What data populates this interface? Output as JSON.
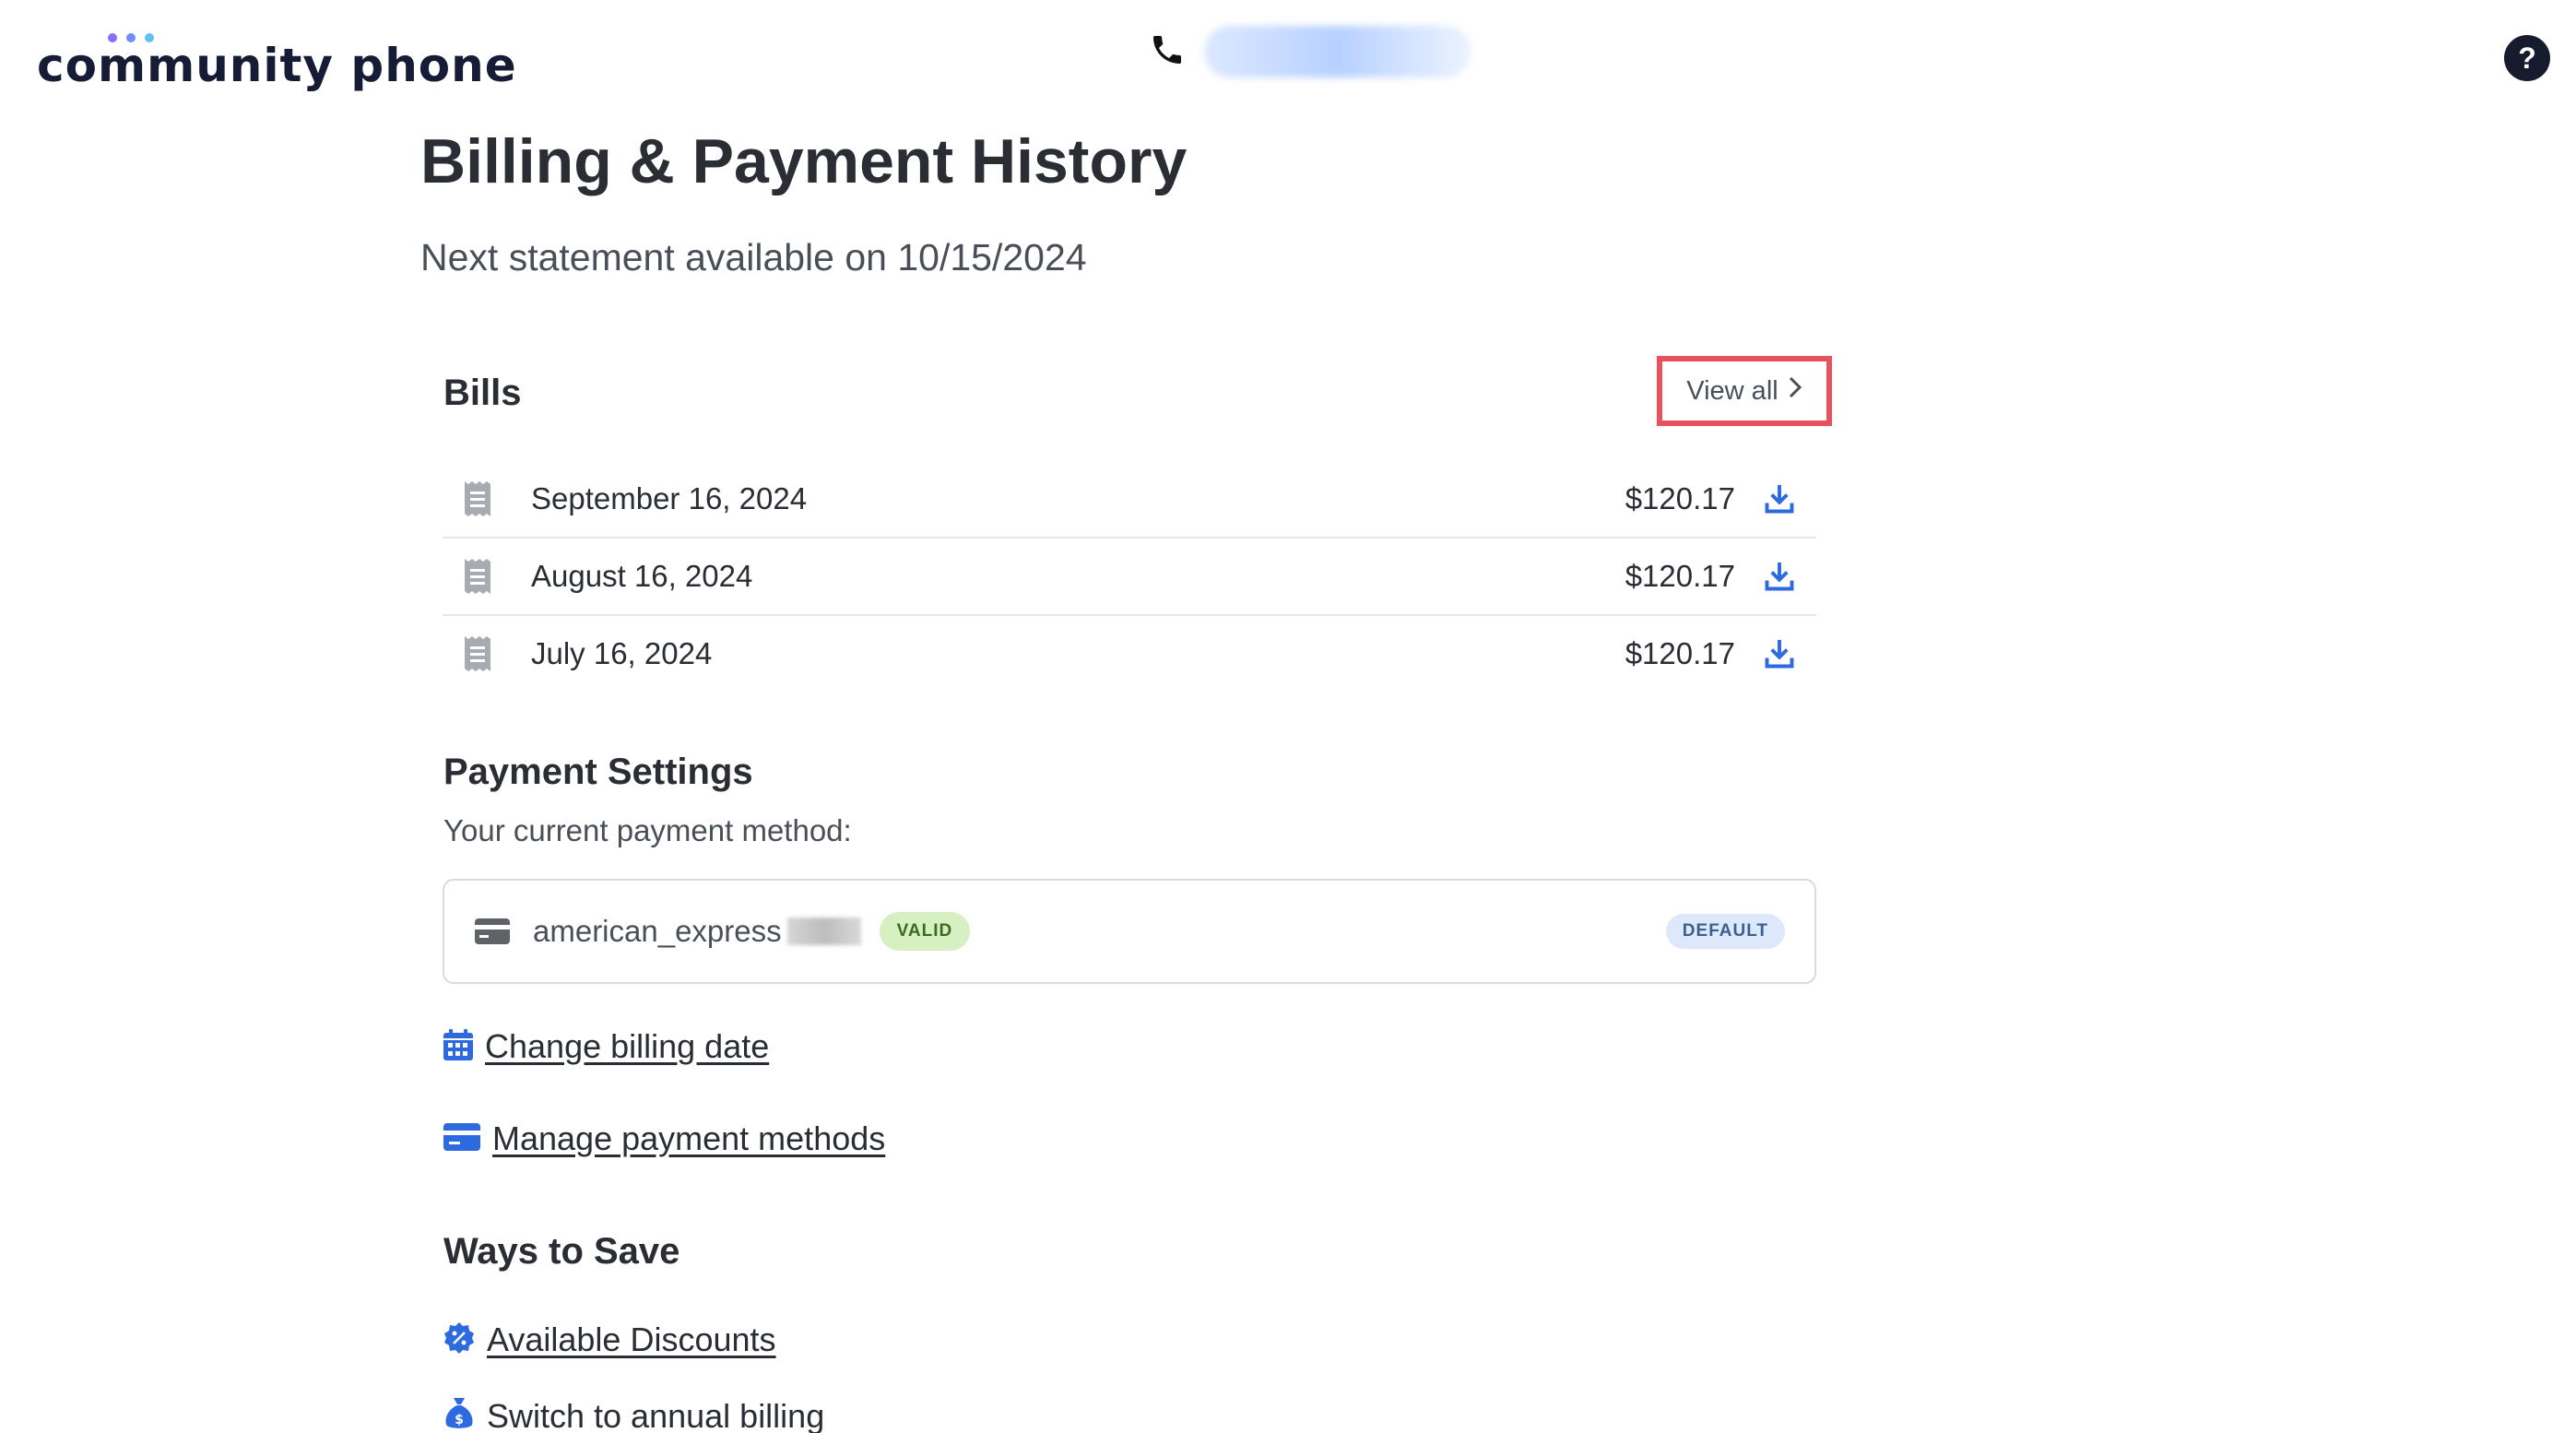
{
  "header": {
    "logo_text": "community phone",
    "logo_dot_colors": [
      "#8b6cf6",
      "#6f8cf8",
      "#5cc2f0"
    ],
    "phone_number_hidden": true,
    "help_icon": "question-circle-icon",
    "help_label": "?"
  },
  "page": {
    "title": "Billing & Payment History",
    "subtitle": "Next statement available on 10/15/2024"
  },
  "bills": {
    "heading": "Bills",
    "view_all_label": "View all",
    "view_all_icon": "chevron-right-icon",
    "highlight_color": "#e8515e",
    "items": [
      {
        "date": "September 16, 2024",
        "amount": "$120.17"
      },
      {
        "date": "August 16, 2024",
        "amount": "$120.17"
      },
      {
        "date": "July 16, 2024",
        "amount": "$120.17"
      }
    ]
  },
  "payment_settings": {
    "heading": "Payment Settings",
    "current_label": "Your current payment method:",
    "method": {
      "name": "american_express",
      "number_hidden": true,
      "status_badge": "VALID",
      "default_badge": "DEFAULT"
    },
    "links": {
      "change_billing_date": "Change billing date",
      "manage_payment_methods": "Manage payment methods"
    }
  },
  "ways_to_save": {
    "heading": "Ways to Save",
    "links": {
      "available_discounts": "Available Discounts",
      "switch_annual": "Switch to annual billing"
    }
  },
  "colors": {
    "accent_blue": "#2d6ae0",
    "text_dark": "#2a2d33",
    "text_muted": "#4a4f57"
  }
}
